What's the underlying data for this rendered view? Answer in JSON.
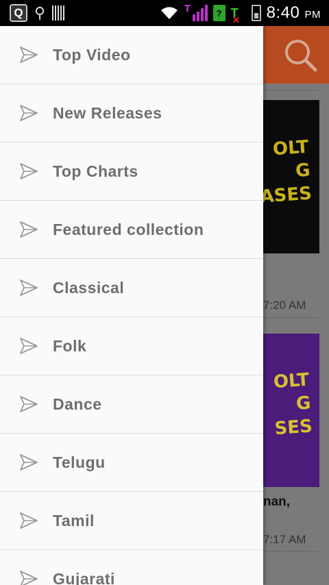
{
  "status_bar": {
    "q_badge": "Q",
    "time": "8:40",
    "ampm": "PM",
    "sim_badge": "?"
  },
  "background": {
    "time_1": "7:20 AM",
    "snippet": "nan,",
    "time_2": "7:17 AM",
    "thumb_text_1": "OLT\nG\nASES",
    "thumb_text_2": "OLT\nG\nSES"
  },
  "menu": {
    "items": [
      {
        "label": "Top Video",
        "icon": "send-icon"
      },
      {
        "label": "New Releases",
        "icon": "send-icon"
      },
      {
        "label": "Top Charts",
        "icon": "send-icon"
      },
      {
        "label": "Featured collection",
        "icon": "send-icon"
      },
      {
        "label": "Classical",
        "icon": "send-icon"
      },
      {
        "label": "Folk",
        "icon": "send-icon"
      },
      {
        "label": "Dance",
        "icon": "send-icon"
      },
      {
        "label": "Telugu",
        "icon": "send-icon"
      },
      {
        "label": "Tamil",
        "icon": "send-icon"
      },
      {
        "label": "Gujarati",
        "icon": "send-icon"
      }
    ]
  },
  "colors": {
    "header": "#b84a1f",
    "drawer_bg": "#fafafa",
    "menu_text": "#6e6e6e"
  }
}
